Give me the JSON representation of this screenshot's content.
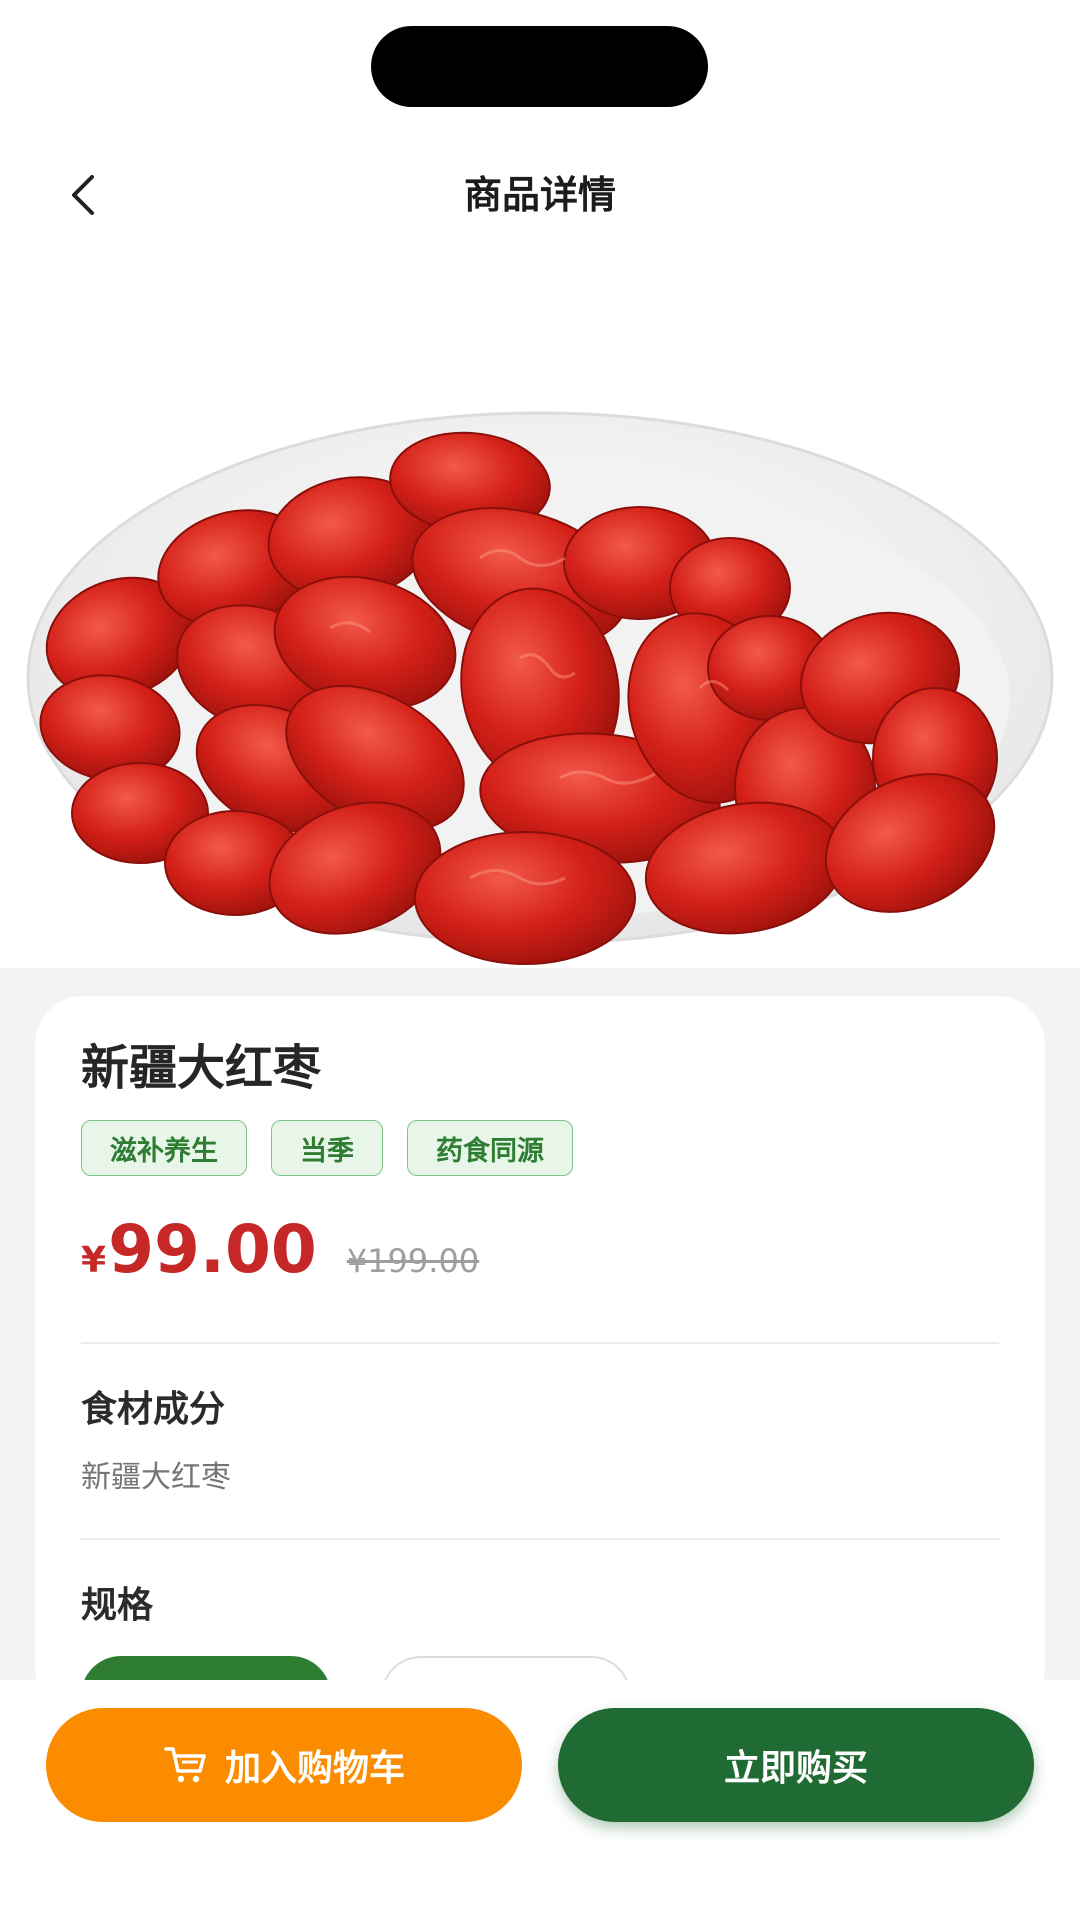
{
  "header": {
    "title": "商品详情",
    "back_icon": "chevron-left-icon"
  },
  "product": {
    "name": "新疆大红枣",
    "tags": [
      "滋补养生",
      "当季",
      "药食同源"
    ],
    "currency": "¥",
    "price": "99.00",
    "original_price": "¥199.00",
    "image": "red-dates-plate-photo"
  },
  "ingredients": {
    "title": "食材成分",
    "text": "新疆大红枣"
  },
  "specs": {
    "title": "规格"
  },
  "actions": {
    "cart_label": "加入购物车",
    "cart_icon": "cart-icon",
    "buy_label": "立即购买"
  },
  "colors": {
    "accent_green": "#1f6b33",
    "price_red": "#c62828",
    "cart_orange": "#fb8c00"
  }
}
